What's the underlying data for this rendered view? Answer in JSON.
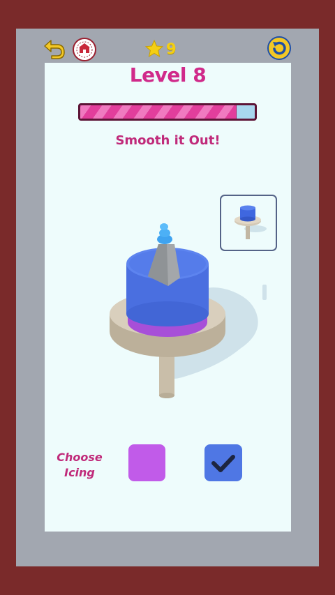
{
  "header": {
    "stars": "9"
  },
  "level": {
    "title": "Level 8",
    "progress_percent": 89,
    "instruction": "Smooth it Out!"
  },
  "icing": {
    "label_line1": "Choose",
    "label_line2": "Icing",
    "options": [
      {
        "name": "purple",
        "color": "#c15be9",
        "selected": false
      },
      {
        "name": "blue",
        "color": "#4f77e4",
        "selected": true
      }
    ]
  },
  "icons": {
    "back": "back-arrow-icon",
    "badge": "cake-shop-badge-icon",
    "star": "star-icon",
    "restart": "restart-icon",
    "check": "checkmark-icon"
  },
  "colors": {
    "accent": "#d02a8a",
    "star": "#f4cf13",
    "cake_blue": "#4f77e4",
    "cake_purple": "#b05ae0",
    "border": "#7a2a2a"
  }
}
